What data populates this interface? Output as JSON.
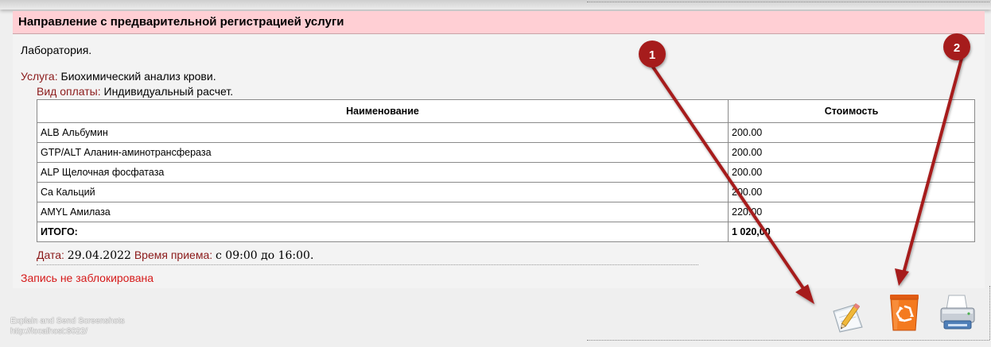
{
  "header": {
    "title": "Направление с предварительной регистрацией услуги"
  },
  "department": "Лаборатория.",
  "service": {
    "label": "Услуга:",
    "value": "Биохимический анализ крови."
  },
  "payment": {
    "label": "Вид оплаты:",
    "value": "Индивидуальный расчет."
  },
  "table": {
    "columns": [
      "Наименование",
      "Стоимость"
    ],
    "rows": [
      {
        "name": "ALB Альбумин",
        "price": "200.00"
      },
      {
        "name": "GTP/ALT Аланин-аминотрансфераза",
        "price": "200.00"
      },
      {
        "name": "ALP Щелочная фосфатаза",
        "price": "200.00"
      },
      {
        "name": "Ca Кальций",
        "price": "200.00"
      },
      {
        "name": "AMYL Амилаза",
        "price": "220.00"
      }
    ],
    "total": {
      "label": "ИТОГО:",
      "value": "1 020,00"
    }
  },
  "appointment": {
    "date_label": "Дата:",
    "date_value": "29.04.2022",
    "time_label": "Время приема:",
    "time_value": "с 09:00 до 16:00."
  },
  "lock_status": "Запись не заблокирована",
  "annotations": {
    "badge1": "1",
    "badge2": "2",
    "color": "#a61c1c"
  },
  "watermark": {
    "line1": "Explain and Send Screenshots",
    "line2": "http://localhost:8022/"
  },
  "icons": {
    "edit": "edit-pencil-icon",
    "delete": "recycle-bin-icon",
    "print": "printer-icon"
  },
  "colors": {
    "header_bg": "#ffcfd4",
    "label_red": "#8b1a1a",
    "status_red": "#d61a1a"
  }
}
